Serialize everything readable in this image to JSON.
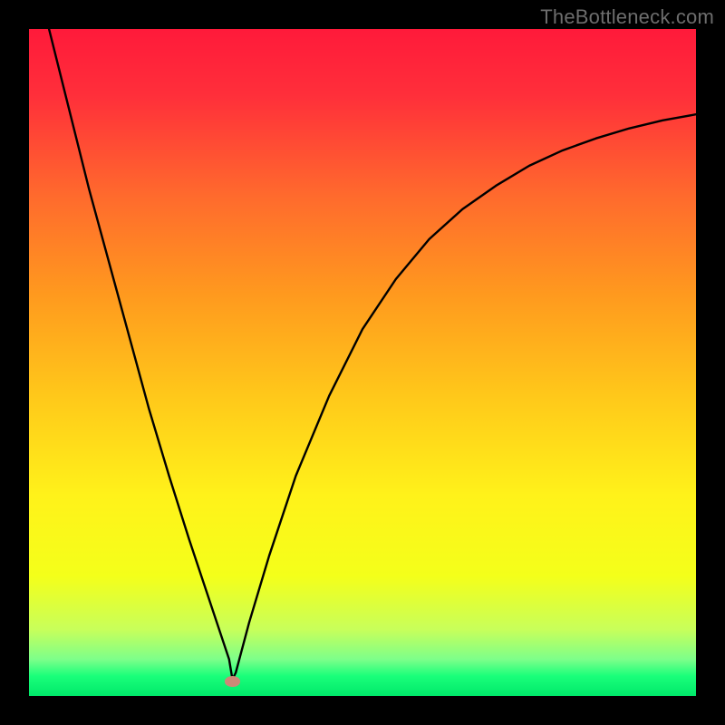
{
  "watermark": "TheBottleneck.com",
  "colors": {
    "frame": "#000000",
    "curve": "#000000",
    "marker": "#cc8877",
    "gradient_stops": [
      {
        "offset": 0.0,
        "color": "#ff1a3a"
      },
      {
        "offset": 0.1,
        "color": "#ff2f3a"
      },
      {
        "offset": 0.25,
        "color": "#ff6a2d"
      },
      {
        "offset": 0.4,
        "color": "#ff9a1e"
      },
      {
        "offset": 0.55,
        "color": "#ffc81a"
      },
      {
        "offset": 0.7,
        "color": "#fff21a"
      },
      {
        "offset": 0.82,
        "color": "#f4ff1a"
      },
      {
        "offset": 0.9,
        "color": "#c8ff5a"
      },
      {
        "offset": 0.945,
        "color": "#7dff8a"
      },
      {
        "offset": 0.97,
        "color": "#1aff7a"
      },
      {
        "offset": 1.0,
        "color": "#00e86a"
      }
    ]
  },
  "chart_data": {
    "type": "line",
    "title": "",
    "xlabel": "",
    "ylabel": "",
    "xlim": [
      0,
      100
    ],
    "ylim": [
      0,
      100
    ],
    "grid": false,
    "legend": false,
    "series": [
      {
        "name": "bottleneck-curve",
        "x": [
          3,
          6,
          9,
          12,
          15,
          18,
          21,
          24,
          27,
          30,
          30.5,
          31,
          33,
          36,
          40,
          45,
          50,
          55,
          60,
          65,
          70,
          75,
          80,
          85,
          90,
          95,
          100
        ],
        "y": [
          100,
          88,
          76,
          65,
          54,
          43,
          33,
          23.5,
          14.5,
          5.5,
          2.5,
          3.5,
          11,
          21,
          33,
          45,
          55,
          62.5,
          68.5,
          73,
          76.5,
          79.5,
          81.8,
          83.6,
          85.1,
          86.3,
          87.2
        ]
      }
    ],
    "annotations": [
      {
        "name": "min-marker",
        "x": 30.5,
        "y": 2.2,
        "shape": "ellipse",
        "rx": 1.2,
        "ry": 0.8,
        "color": "#cc8877"
      }
    ],
    "notes": "V-shaped bottleneck curve on a vertical red→yellow→green gradient. Minimum (optimal point) near x≈30.5%. Right branch rises and flattens toward ~87% at x=100. Values estimated from pixels; no axis ticks or labels present."
  }
}
